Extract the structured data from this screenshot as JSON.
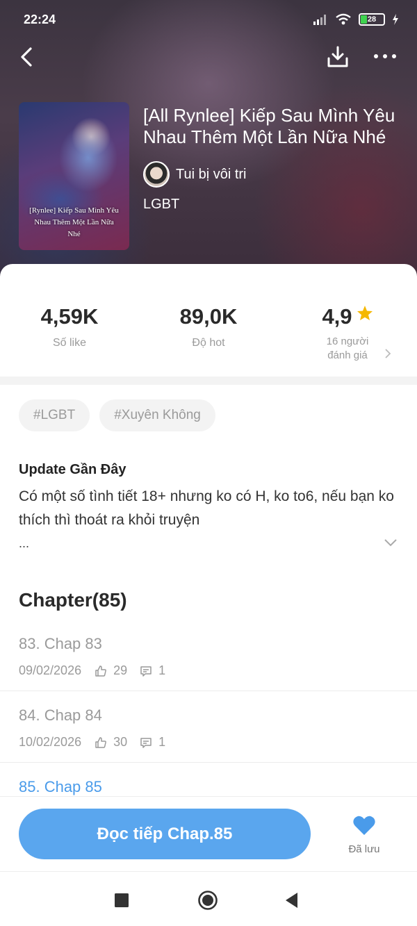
{
  "status": {
    "time": "22:24",
    "battery": "28"
  },
  "book": {
    "title": "[All Rynlee] Kiếp Sau Mình Yêu Nhau Thêm Một Lần Nữa Nhé",
    "cover_text": "[Rynlee] Kiếp Sau Mình Yêu Nhau Thêm Một Lần Nữa Nhé",
    "author": "Tui bị vôi tri",
    "category": "LGBT"
  },
  "stats": {
    "likes": {
      "value": "4,59K",
      "label": "Số like"
    },
    "hot": {
      "value": "89,0K",
      "label": "Độ hot"
    },
    "rating": {
      "value": "4,9",
      "label_line1": "16 người",
      "label_line2": "đánh giá"
    }
  },
  "tags": [
    "#LGBT",
    "#Xuyên Không"
  ],
  "update": {
    "title": "Update Gần Đây",
    "body": "Có một số tình tiết 18+ nhưng ko có H, ko to6, nếu bạn ko thích thì thoát ra khỏi truyện",
    "more": "..."
  },
  "chapters": {
    "heading": "Chapter(85)",
    "items": [
      {
        "title": "83. Chap 83",
        "date": "09/02/2026",
        "likes": "29",
        "comments": "1"
      },
      {
        "title": "84. Chap 84",
        "date": "10/02/2026",
        "likes": "30",
        "comments": "1"
      },
      {
        "title": "85. Chap 85",
        "date": "",
        "likes": "",
        "comments": ""
      }
    ]
  },
  "actions": {
    "read_label": "Đọc tiếp Chap.85",
    "saved_label": "Đã lưu"
  },
  "colors": {
    "accent": "#5aa6ee",
    "link": "#4a9bea",
    "star": "#f5b800",
    "heart": "#4a9bea"
  },
  "icons": [
    "back-arrow-icon",
    "download-icon",
    "more-icon",
    "star-icon",
    "chevron-right-icon",
    "chevron-down-icon",
    "thumbs-up-icon",
    "comment-icon",
    "heart-icon",
    "square-icon",
    "circle-icon",
    "triangle-back-icon"
  ]
}
